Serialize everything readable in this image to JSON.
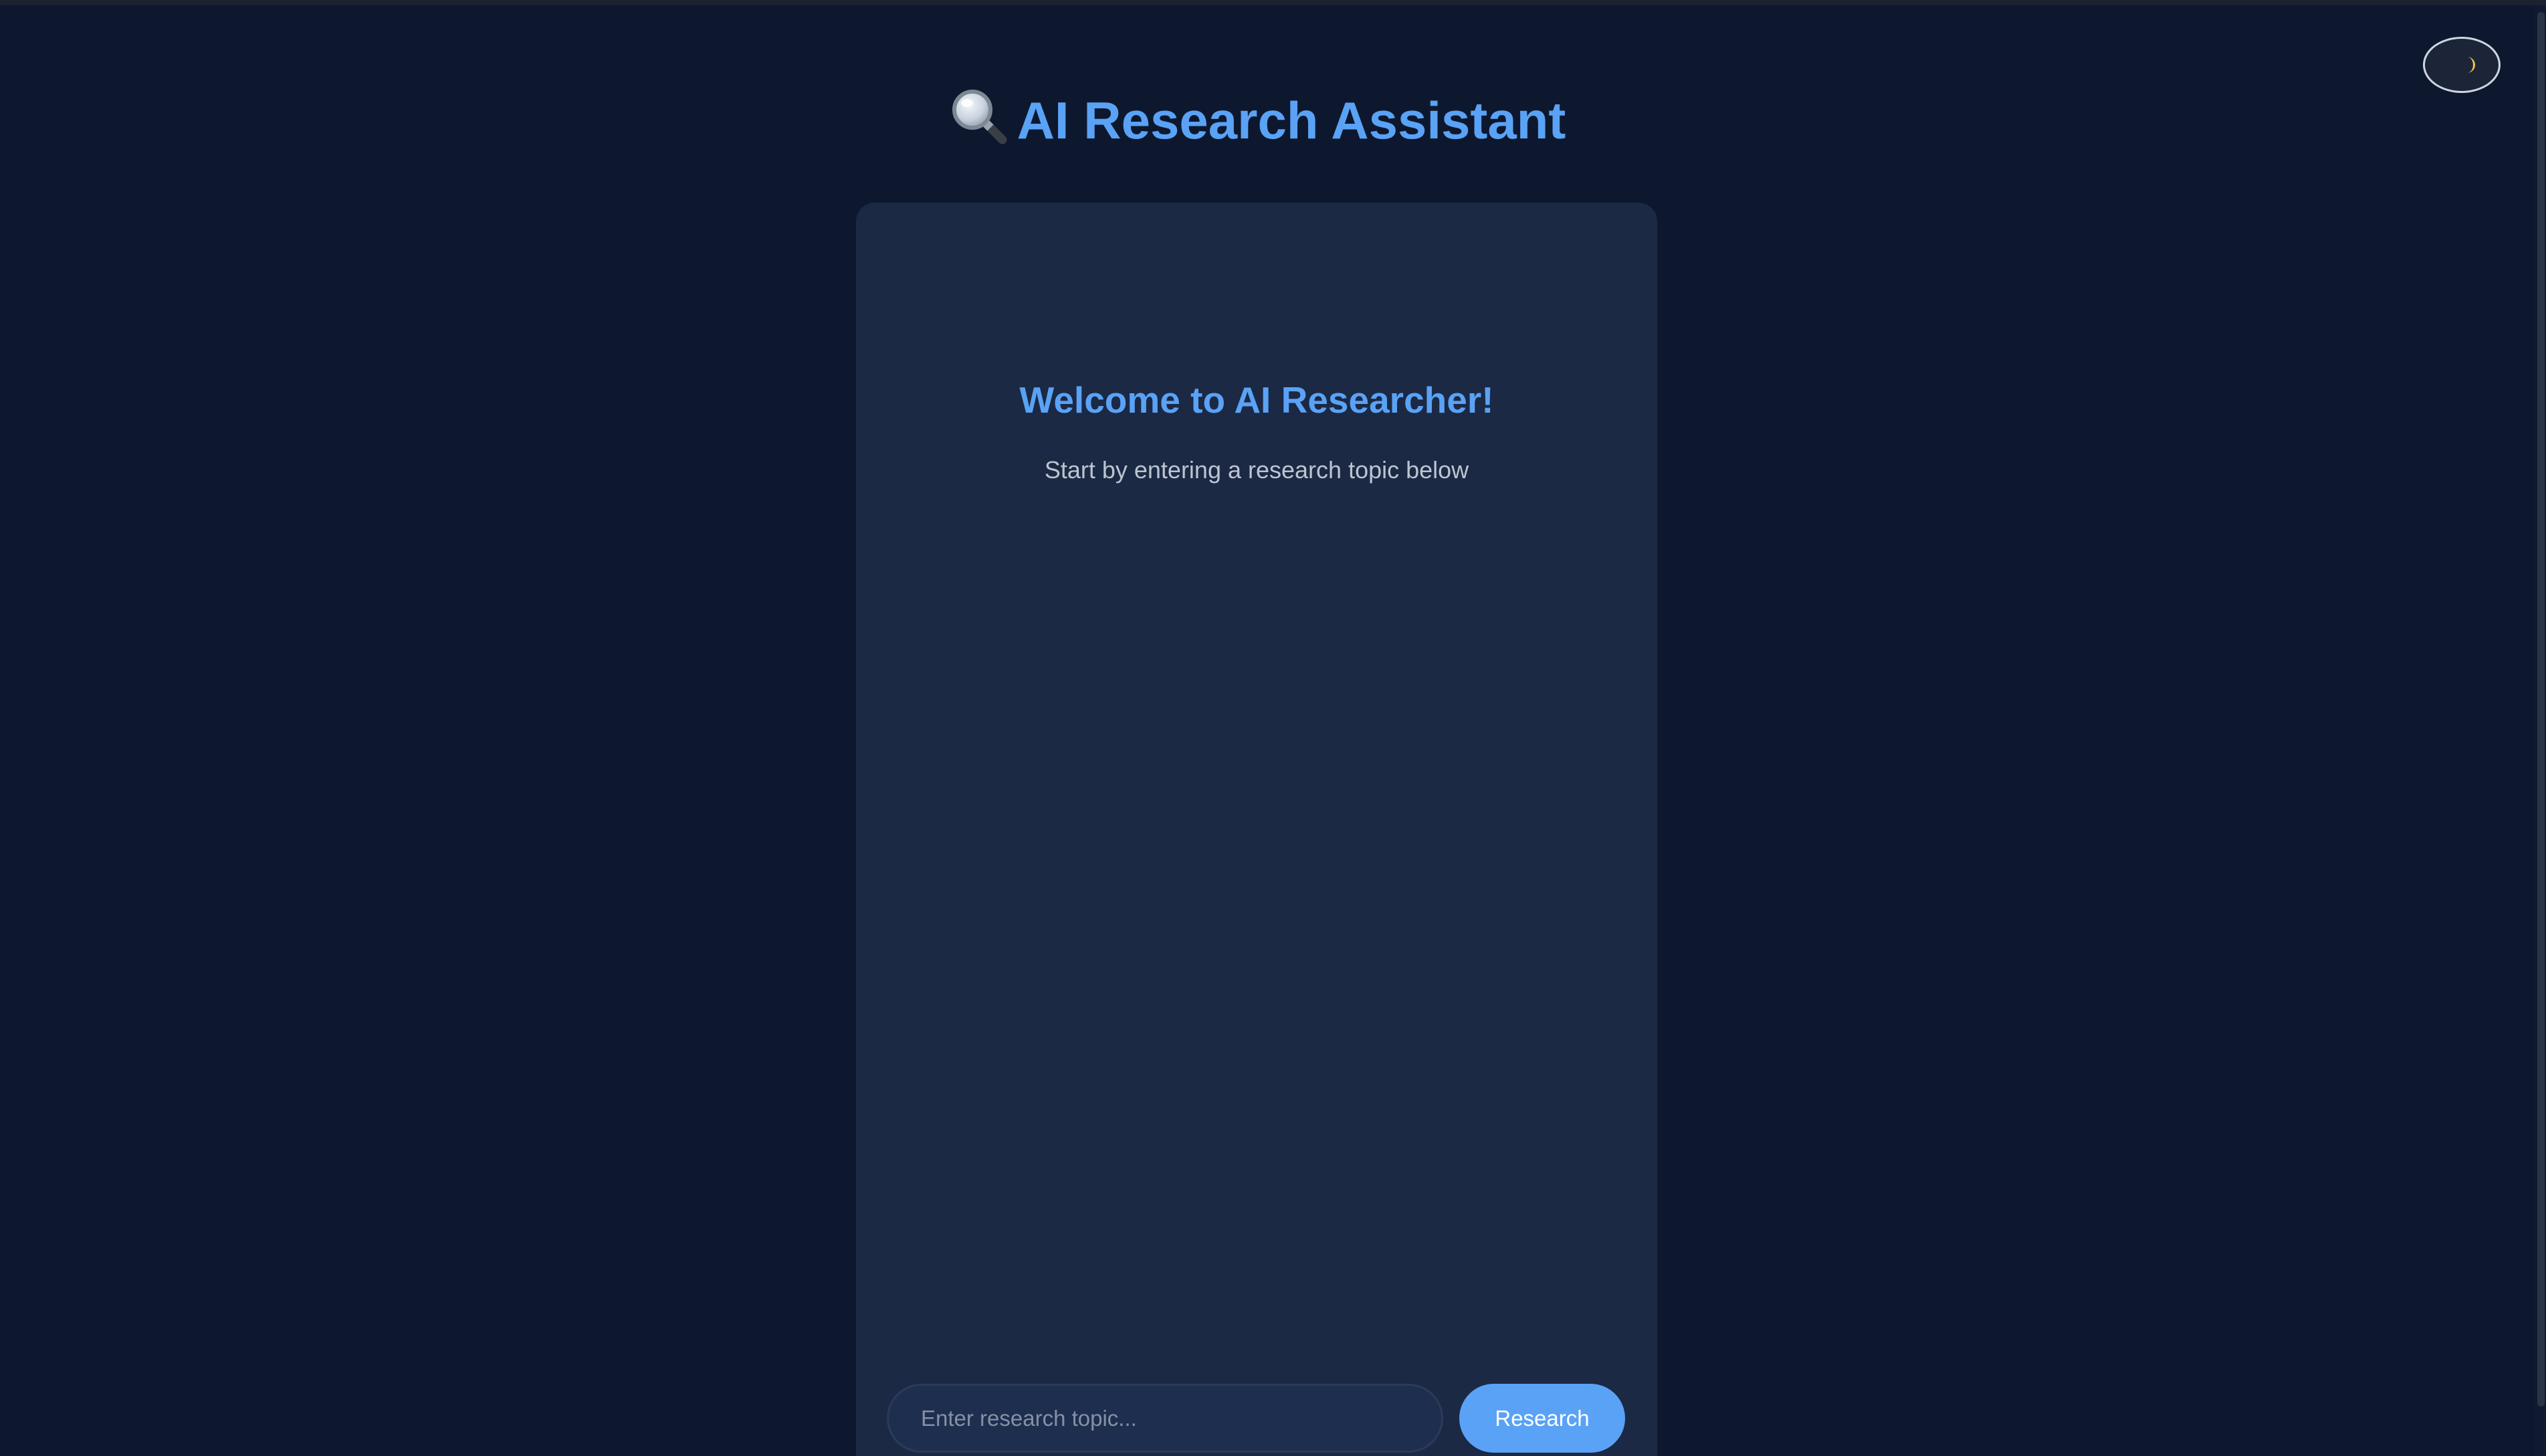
{
  "header": {
    "title": "AI Research Assistant",
    "title_icon": "magnifying-glass-icon"
  },
  "theme_toggle": {
    "icon": "moon-icon"
  },
  "welcome": {
    "title": "Welcome to AI Researcher!",
    "subtitle": "Start by entering a research topic below"
  },
  "search": {
    "placeholder": "Enter research topic...",
    "value": "",
    "button_label": "Research"
  },
  "colors": {
    "background": "#0d182e",
    "card": "#1b2944",
    "accent": "#5aa2f5",
    "subtitle_text": "#bcc4d0",
    "input_background": "#1e2e4f"
  }
}
